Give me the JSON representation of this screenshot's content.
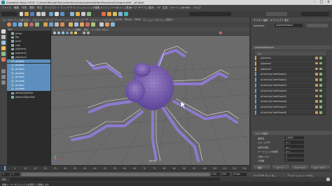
{
  "window": {
    "title": "Autodesk Maya 2018: C:\\Users\\Nicolai\\Documents\\maya\\projects\\default\\scenes\\Octopus.mb* - pCube1"
  },
  "menu": [
    "ファイル",
    "編集",
    "作成",
    "選択",
    "修正",
    "ディスプレイ",
    "ウィンドウ",
    "メッシュ",
    "メッシュの編集",
    "メッシュ ツール",
    "メッシュ表示",
    "カーブ",
    "サーフェス",
    "変形",
    "UV",
    "生成",
    "キャッシュ",
    "Arnold",
    "ヘルプ"
  ],
  "shelf_tabs": [
    "カーブ/サーフェス",
    "ポリゴン",
    "スカルプト",
    "リギング",
    "アニメーション",
    "レンダリング",
    "FX",
    "FX キャッシュ",
    "カスタム",
    "Arnold",
    "Bifrost",
    "MASH",
    "モーション グラフィックス",
    "XGen"
  ],
  "viewport": {
    "menu": [
      "ビュー",
      "シェーディング",
      "照明",
      "表示",
      "レンダラ",
      "パネル"
    ],
    "camera_label": "persp"
  },
  "outliner": {
    "items": [
      {
        "label": "persp",
        "selected": false
      },
      {
        "label": "top",
        "selected": false
      },
      {
        "label": "front",
        "selected": false
      },
      {
        "label": "side",
        "selected": false
      },
      {
        "label": "pSphere1",
        "selected": false
      },
      {
        "label": "pSphere2",
        "selected": false
      },
      {
        "label": "pSphere3",
        "selected": false
      },
      {
        "label": "pCube1",
        "selected": true
      },
      {
        "label": "pCube2",
        "selected": true
      },
      {
        "label": "pCube3",
        "selected": true
      },
      {
        "label": "pCube4",
        "selected": true
      },
      {
        "label": "pCube5",
        "selected": true
      },
      {
        "label": "pCube6",
        "selected": true
      },
      {
        "label": "pCube7",
        "selected": true
      },
      {
        "label": "pCube8",
        "selected": true
      },
      {
        "label": "defaultLightSet",
        "selected": false
      },
      {
        "label": "defaultObjectSet",
        "selected": false
      }
    ]
  },
  "attr_editor": {
    "tabs": [
      "チャネル",
      "編集",
      "オブジェクト",
      "表示"
    ],
    "node_label": "pSphereShape1",
    "section": "polySmoothFace1",
    "inputs_header": "入力",
    "rows": [
      "pSphere1",
      "pSphere2",
      "pSphere3",
      "pCube1(pCubeShape1)",
      "pCube1(pCubeShape2)",
      "pCube1(pCubeShape3)",
      "pCube1(pCubeShape4)",
      "pCube1(pCubeShape5)",
      "pCube1(pCubeShape6)",
      "pCube1(pCubeShape7)",
      "pCube1(pCubeShape8)"
    ],
    "smooth_section": "スムーズ設定",
    "props": [
      {
        "label": "連続性",
        "value": "1.0000"
      },
      {
        "label": "スムーズ UV",
        "value": "オン"
      },
      {
        "label": "境界を保持",
        "value": "オン"
      },
      {
        "label": "ハード エッジを保持",
        "value": "オフ"
      },
      {
        "label": "分割レベル",
        "value": "2"
      },
      {
        "label": "分割数",
        "value": "1"
      }
    ],
    "buttons": [
      "選択",
      "ロード",
      "フォーカス",
      "コピー タブ"
    ]
  },
  "time": {
    "ticks": [
      "1",
      "5",
      "10",
      "15",
      "20",
      "25",
      "30",
      "35",
      "40",
      "45",
      "50",
      "55",
      "60",
      "65",
      "70",
      "75",
      "80",
      "85",
      "90",
      "95",
      "100",
      "105",
      "110",
      "115",
      "120"
    ],
    "current": "1"
  },
  "range": {
    "start": "1",
    "start2": "1",
    "end": "120",
    "end2": "200",
    "fps": "24 fps",
    "char": "キャラクタ セットなし",
    "anim": "アニメーション レイヤなし"
  },
  "cmd": {
    "label": "MEL"
  },
  "help": "移動ツール: オブジェクトを選択して移動します"
}
